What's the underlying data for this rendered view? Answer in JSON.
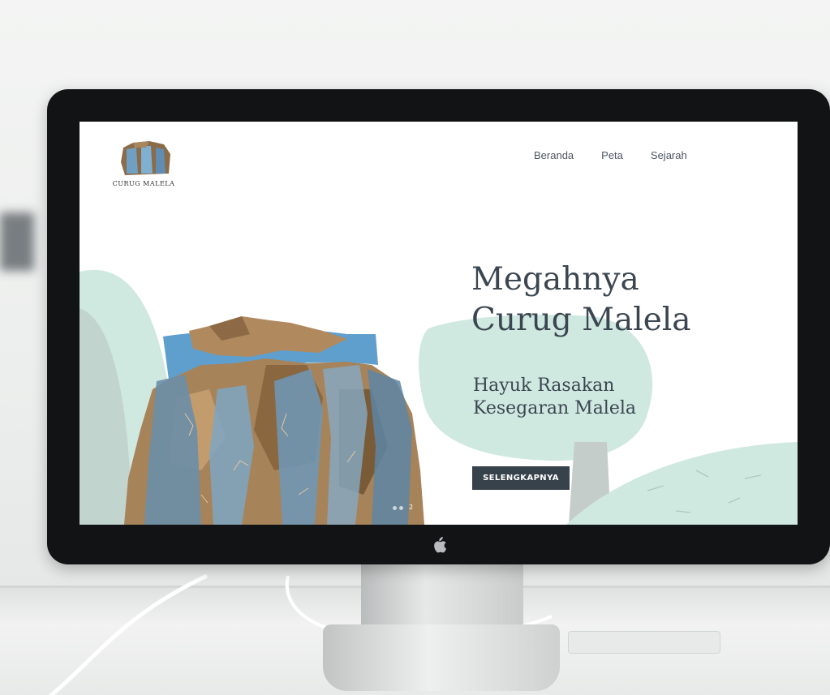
{
  "site": {
    "logo_text": "CURUG MALELA"
  },
  "nav": {
    "items": [
      {
        "label": "Beranda"
      },
      {
        "label": "Peta"
      },
      {
        "label": "Sejarah"
      }
    ]
  },
  "hero": {
    "title_line1": "Megahnya",
    "title_line2": "Curug Malela",
    "subtitle_line1": "Hayuk Rasakan",
    "subtitle_line2": "Kesegaran Malela",
    "cta_label": "SELENGKAPNYA"
  },
  "slider": {
    "current": "2"
  },
  "colors": {
    "text_dark": "#3b4650",
    "button_bg": "#37424b",
    "mint": "#cfe9e1",
    "water": "#5f9fce",
    "rock": "#b08a5e",
    "monitor_bezel": "#111314"
  },
  "icons": {
    "apple": "apple-logo-icon",
    "logo": "waterfall-logo-icon"
  }
}
